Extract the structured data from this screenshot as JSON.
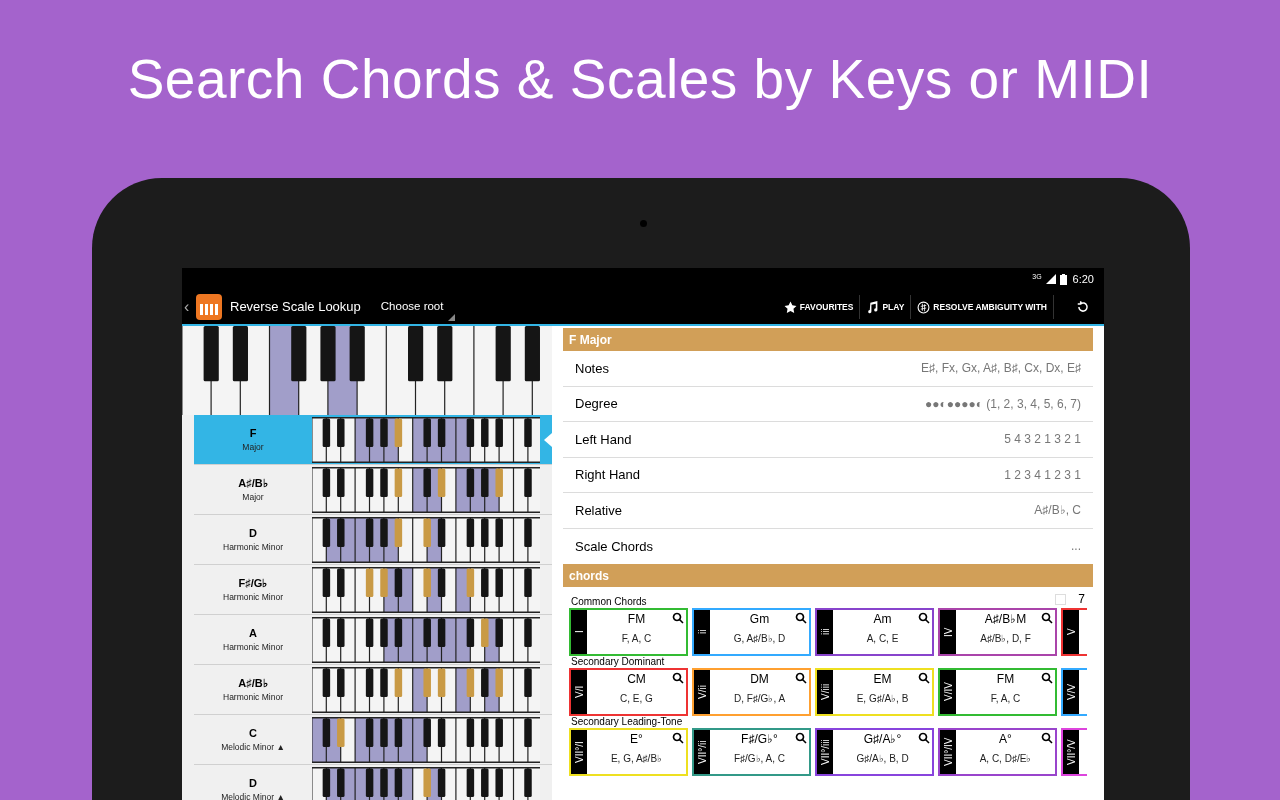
{
  "headline": "Search Chords & Scales by Keys or MIDI",
  "status_bar": {
    "network": "3G",
    "time": "6:20"
  },
  "action_bar": {
    "back": "‹",
    "title": "Reverse Scale Lookup",
    "spinner": "Choose root",
    "actions": [
      {
        "kind": "favourites",
        "label": "FAVOURITES"
      },
      {
        "kind": "play",
        "label": "PLAY"
      },
      {
        "kind": "resolve",
        "label": "RESOLVE AMBIGUITY WITH"
      },
      {
        "kind": "reset"
      }
    ]
  },
  "keyboard": {
    "white_marked": [
      false,
      false,
      false,
      true,
      false,
      true,
      false,
      false,
      false,
      false,
      false,
      false,
      false
    ],
    "black_marked": [
      false,
      false,
      false,
      false,
      false,
      false,
      false,
      false,
      false
    ]
  },
  "results": [
    {
      "root": "F",
      "scale": "Major",
      "selected": true,
      "white_marked": [
        false,
        false,
        false,
        true,
        true,
        true,
        false,
        true,
        true,
        true,
        true,
        false,
        false,
        false,
        false,
        false
      ],
      "black_marked": [
        false,
        false,
        false,
        false,
        true,
        false,
        false,
        false,
        false,
        false,
        false
      ]
    },
    {
      "root": "A♯/B♭",
      "scale": "Major",
      "selected": false,
      "white_marked": [
        false,
        false,
        false,
        false,
        false,
        false,
        false,
        true,
        true,
        false,
        true,
        true,
        true,
        false,
        false,
        false
      ],
      "black_marked": [
        false,
        false,
        false,
        false,
        true,
        false,
        true,
        false,
        false,
        true,
        false
      ]
    },
    {
      "root": "D",
      "scale": "Harmonic Minor",
      "selected": false,
      "white_marked": [
        false,
        true,
        true,
        true,
        true,
        true,
        false,
        false,
        true,
        false,
        false,
        false,
        false,
        false,
        false,
        false
      ],
      "black_marked": [
        false,
        false,
        false,
        false,
        true,
        true,
        false,
        false,
        false,
        false,
        false
      ]
    },
    {
      "root": "F♯/G♭",
      "scale": "Harmonic Minor",
      "selected": false,
      "white_marked": [
        false,
        false,
        false,
        false,
        false,
        true,
        true,
        false,
        true,
        false,
        true,
        false,
        false,
        false,
        false,
        false
      ],
      "black_marked": [
        false,
        false,
        true,
        true,
        false,
        true,
        false,
        true,
        false,
        false,
        false
      ]
    },
    {
      "root": "A",
      "scale": "Harmonic Minor",
      "selected": false,
      "white_marked": [
        false,
        false,
        false,
        false,
        false,
        true,
        true,
        true,
        true,
        true,
        true,
        false,
        true,
        false,
        false,
        false
      ],
      "black_marked": [
        false,
        false,
        false,
        false,
        false,
        false,
        false,
        false,
        true,
        false,
        false
      ]
    },
    {
      "root": "A♯/B♭",
      "scale": "Harmonic Minor",
      "selected": false,
      "white_marked": [
        false,
        false,
        false,
        false,
        false,
        false,
        false,
        true,
        false,
        false,
        true,
        false,
        true,
        false,
        false,
        false
      ],
      "black_marked": [
        false,
        false,
        false,
        false,
        true,
        true,
        true,
        true,
        false,
        true,
        false
      ]
    },
    {
      "root": "C",
      "scale": "Melodic Minor ▲",
      "selected": false,
      "white_marked": [
        true,
        true,
        false,
        true,
        true,
        true,
        true,
        true,
        false,
        false,
        false,
        false,
        false,
        false,
        false,
        false
      ],
      "black_marked": [
        false,
        true,
        false,
        false,
        false,
        false,
        false,
        false,
        false,
        false,
        false
      ]
    },
    {
      "root": "D",
      "scale": "Melodic Minor ▲",
      "selected": false,
      "white_marked": [
        false,
        true,
        true,
        true,
        true,
        true,
        true,
        false,
        true,
        false,
        false,
        false,
        false,
        false,
        false,
        false
      ],
      "black_marked": [
        false,
        false,
        false,
        false,
        false,
        true,
        false,
        false,
        false,
        false,
        false
      ]
    }
  ],
  "detail": {
    "title": "F Major",
    "properties": [
      {
        "label": "Notes",
        "value": "E♯, Fx, Gx, A♯, B♯, Cx, Dx, E♯"
      },
      {
        "label": "Degree",
        "value": "●●◐●●●●◐ (1, 2, 3, 4, 5, 6, 7)"
      },
      {
        "label": "Left Hand",
        "value": "5 4 3 2 1 3 2 1"
      },
      {
        "label": "Right Hand",
        "value": "1 2 3 4 1 2 3 1"
      },
      {
        "label": "Relative",
        "value": "A♯/B♭, C"
      },
      {
        "label": "Scale Chords",
        "value": "..."
      }
    ]
  },
  "chords": {
    "title": "chords",
    "seventh_checkbox": {
      "label": "7",
      "checked": false
    },
    "groups": [
      {
        "title": "Common Chords",
        "cards": [
          {
            "numeral": "I",
            "name": "FM",
            "notes": "F, A, C",
            "color": "#33bb33"
          },
          {
            "numeral": "ii",
            "name": "Gm",
            "notes": "G, A♯/B♭, D",
            "color": "#33aaff"
          },
          {
            "numeral": "iii",
            "name": "Am",
            "notes": "A, C, E",
            "color": "#8844cc"
          },
          {
            "numeral": "IV",
            "name": "A♯/B♭M",
            "notes": "A♯/B♭, D, F",
            "color": "#aa44aa"
          },
          {
            "numeral": "V",
            "color": "#ee3333"
          }
        ]
      },
      {
        "title": "Secondary Dominant",
        "cards": [
          {
            "numeral": "V/I",
            "name": "CM",
            "notes": "C, E, G",
            "color": "#ee3333"
          },
          {
            "numeral": "V/ii",
            "name": "DM",
            "notes": "D, F♯/G♭, A",
            "color": "#ffa030"
          },
          {
            "numeral": "V/iii",
            "name": "EM",
            "notes": "E, G♯/A♭, B",
            "color": "#eee020"
          },
          {
            "numeral": "V/IV",
            "name": "FM",
            "notes": "F, A, C",
            "color": "#33bb33"
          },
          {
            "numeral": "V/V",
            "color": "#33aaff"
          }
        ]
      },
      {
        "title": "Secondary Leading-Tone",
        "cards": [
          {
            "numeral": "VII°/I",
            "name": "E°",
            "notes": "E, G, A♯/B♭",
            "color": "#eee020"
          },
          {
            "numeral": "VII°/ii",
            "name": "F♯/G♭°",
            "notes": "F♯/G♭, A, C",
            "color": "#339988"
          },
          {
            "numeral": "VII°/iii",
            "name": "G♯/A♭°",
            "notes": "G♯/A♭, B, D",
            "color": "#8844dd"
          },
          {
            "numeral": "VII°/IV",
            "name": "A°",
            "notes": "A, C, D♯/E♭",
            "color": "#9944cc"
          },
          {
            "numeral": "VII°/V",
            "color": "#dd44dd"
          }
        ]
      }
    ]
  }
}
